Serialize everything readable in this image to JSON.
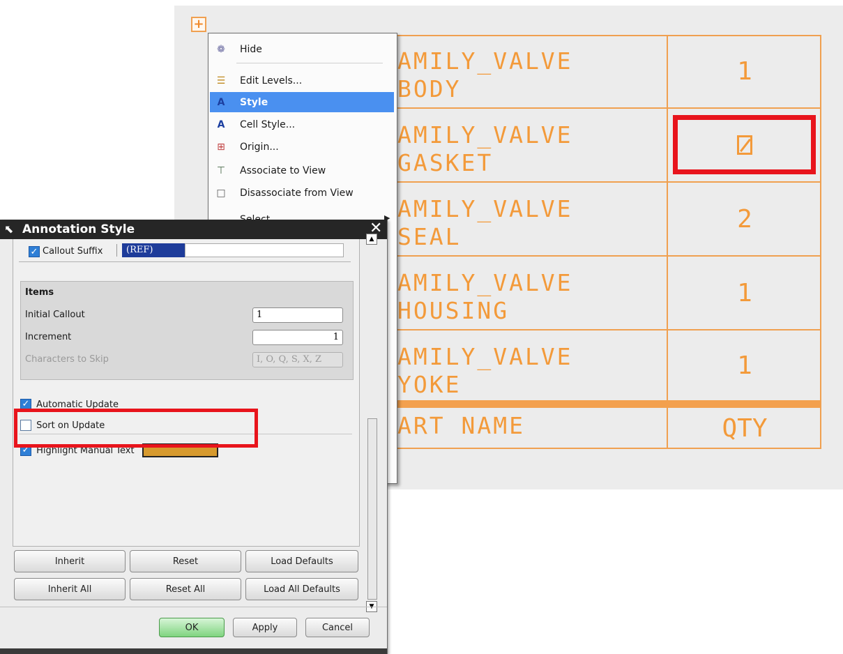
{
  "context_menu": {
    "items": [
      {
        "label": "Hide",
        "icon": "hide-icon"
      },
      {
        "label": "Edit Levels...",
        "icon": "edit-levels-icon"
      },
      {
        "label": "Style",
        "icon": "style-icon",
        "selected": true
      },
      {
        "label": "Cell Style...",
        "icon": "cell-style-icon"
      },
      {
        "label": "Origin...",
        "icon": "origin-icon"
      },
      {
        "label": "Associate to View",
        "icon": "associate-icon"
      },
      {
        "label": "Disassociate from View",
        "icon": "disassociate-icon"
      },
      {
        "label": "Select",
        "icon": "select-icon",
        "has_submenu": true
      }
    ]
  },
  "parts_table": {
    "rows": [
      {
        "name_line1": "AMILY_VALVE",
        "name_line2": "BODY",
        "qty": "1"
      },
      {
        "name_line1": "AMILY_VALVE",
        "name_line2": "GASKET",
        "qty": "",
        "manual_override": true
      },
      {
        "name_line1": "AMILY_VALVE",
        "name_line2": "SEAL",
        "qty": "2"
      },
      {
        "name_line1": "AMILY_VALVE",
        "name_line2": "HOUSING",
        "qty": "1"
      },
      {
        "name_line1": "AMILY_VALVE",
        "name_line2": "YOKE",
        "qty": "1"
      }
    ],
    "header": {
      "name": "ART NAME",
      "qty": "QTY"
    },
    "color": "#f39a3a"
  },
  "dialog": {
    "title": "Annotation Style",
    "callout_suffix_label": "Callout Suffix",
    "callout_suffix_checked": true,
    "callout_suffix_value": "(REF)",
    "items_group_title": "Items",
    "initial_callout_label": "Initial Callout",
    "initial_callout_value": "1",
    "increment_label": "Increment",
    "increment_value": "1",
    "chars_to_skip_label": "Characters to Skip",
    "chars_to_skip_value": "I, O, Q, S, X, Z",
    "automatic_update_label": "Automatic Update",
    "automatic_update_checked": true,
    "sort_on_update_label": "Sort on Update",
    "sort_on_update_checked": false,
    "highlight_manual_label": "Highlight Manual Text",
    "highlight_manual_checked": true,
    "highlight_color": "#d79a2e",
    "buttons": {
      "inherit": "Inherit",
      "reset": "Reset",
      "load_defaults": "Load Defaults",
      "inherit_all": "Inherit All",
      "reset_all": "Reset All",
      "load_all_defaults": "Load All Defaults",
      "ok": "OK",
      "apply": "Apply",
      "cancel": "Cancel"
    }
  },
  "colors": {
    "highlight_box": "#e8141c",
    "menu_selected": "#4a90f0",
    "table_line": "#f0a050"
  }
}
